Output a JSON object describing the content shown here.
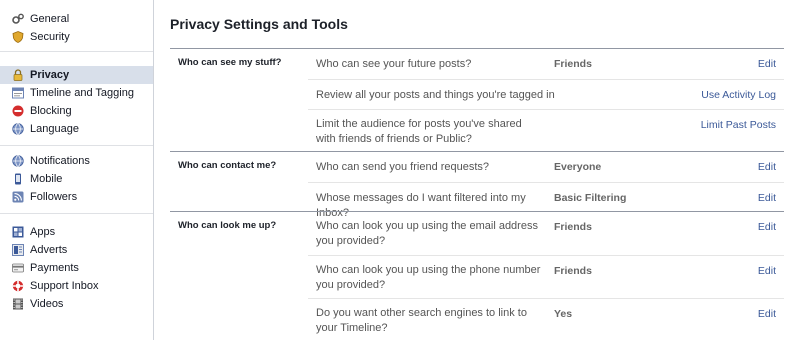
{
  "sidebar": {
    "group1": [
      {
        "label": "General",
        "icon": "gears-icon"
      },
      {
        "label": "Security",
        "icon": "shield-icon"
      }
    ],
    "group2": [
      {
        "label": "Privacy",
        "icon": "lock-icon",
        "active": true
      },
      {
        "label": "Timeline and Tagging",
        "icon": "timeline-icon"
      },
      {
        "label": "Blocking",
        "icon": "block-icon"
      },
      {
        "label": "Language",
        "icon": "globe-icon"
      }
    ],
    "group3": [
      {
        "label": "Notifications",
        "icon": "globe-icon"
      },
      {
        "label": "Mobile",
        "icon": "mobile-icon"
      },
      {
        "label": "Followers",
        "icon": "rss-icon"
      }
    ],
    "group4": [
      {
        "label": "Apps",
        "icon": "apps-icon"
      },
      {
        "label": "Adverts",
        "icon": "adverts-icon"
      },
      {
        "label": "Payments",
        "icon": "card-icon"
      },
      {
        "label": "Support Inbox",
        "icon": "lifebuoy-icon"
      },
      {
        "label": "Videos",
        "icon": "film-icon"
      }
    ]
  },
  "main": {
    "title": "Privacy Settings and Tools",
    "sections": [
      {
        "label": "Who can see my stuff?",
        "rows": [
          {
            "question": "Who can see your future posts?",
            "value": "Friends",
            "action": "Edit"
          },
          {
            "question": "Review all your posts and things you're tagged in",
            "value": "",
            "action": "Use Activity Log"
          },
          {
            "question": "Limit the audience for posts you've shared with friends of friends or Public?",
            "value": "",
            "action": "Limit Past Posts"
          }
        ]
      },
      {
        "label": "Who can contact me?",
        "rows": [
          {
            "question": "Who can send you friend requests?",
            "value": "Everyone",
            "action": "Edit"
          },
          {
            "question": "Whose messages do I want filtered into my Inbox?",
            "value": "Basic Filtering",
            "action": "Edit"
          }
        ]
      },
      {
        "label": "Who can look me up?",
        "rows": [
          {
            "question": "Who can look you up using the email address you provided?",
            "value": "Friends",
            "action": "Edit"
          },
          {
            "question": "Who can look you up using the phone number you provided?",
            "value": "Friends",
            "action": "Edit"
          },
          {
            "question": "Do you want other search engines to link to your Timeline?",
            "value": "Yes",
            "action": "Edit"
          }
        ]
      }
    ]
  },
  "colors": {
    "link": "#3b5998",
    "active_bg": "#d8dfea",
    "divider": "#9197a3"
  }
}
